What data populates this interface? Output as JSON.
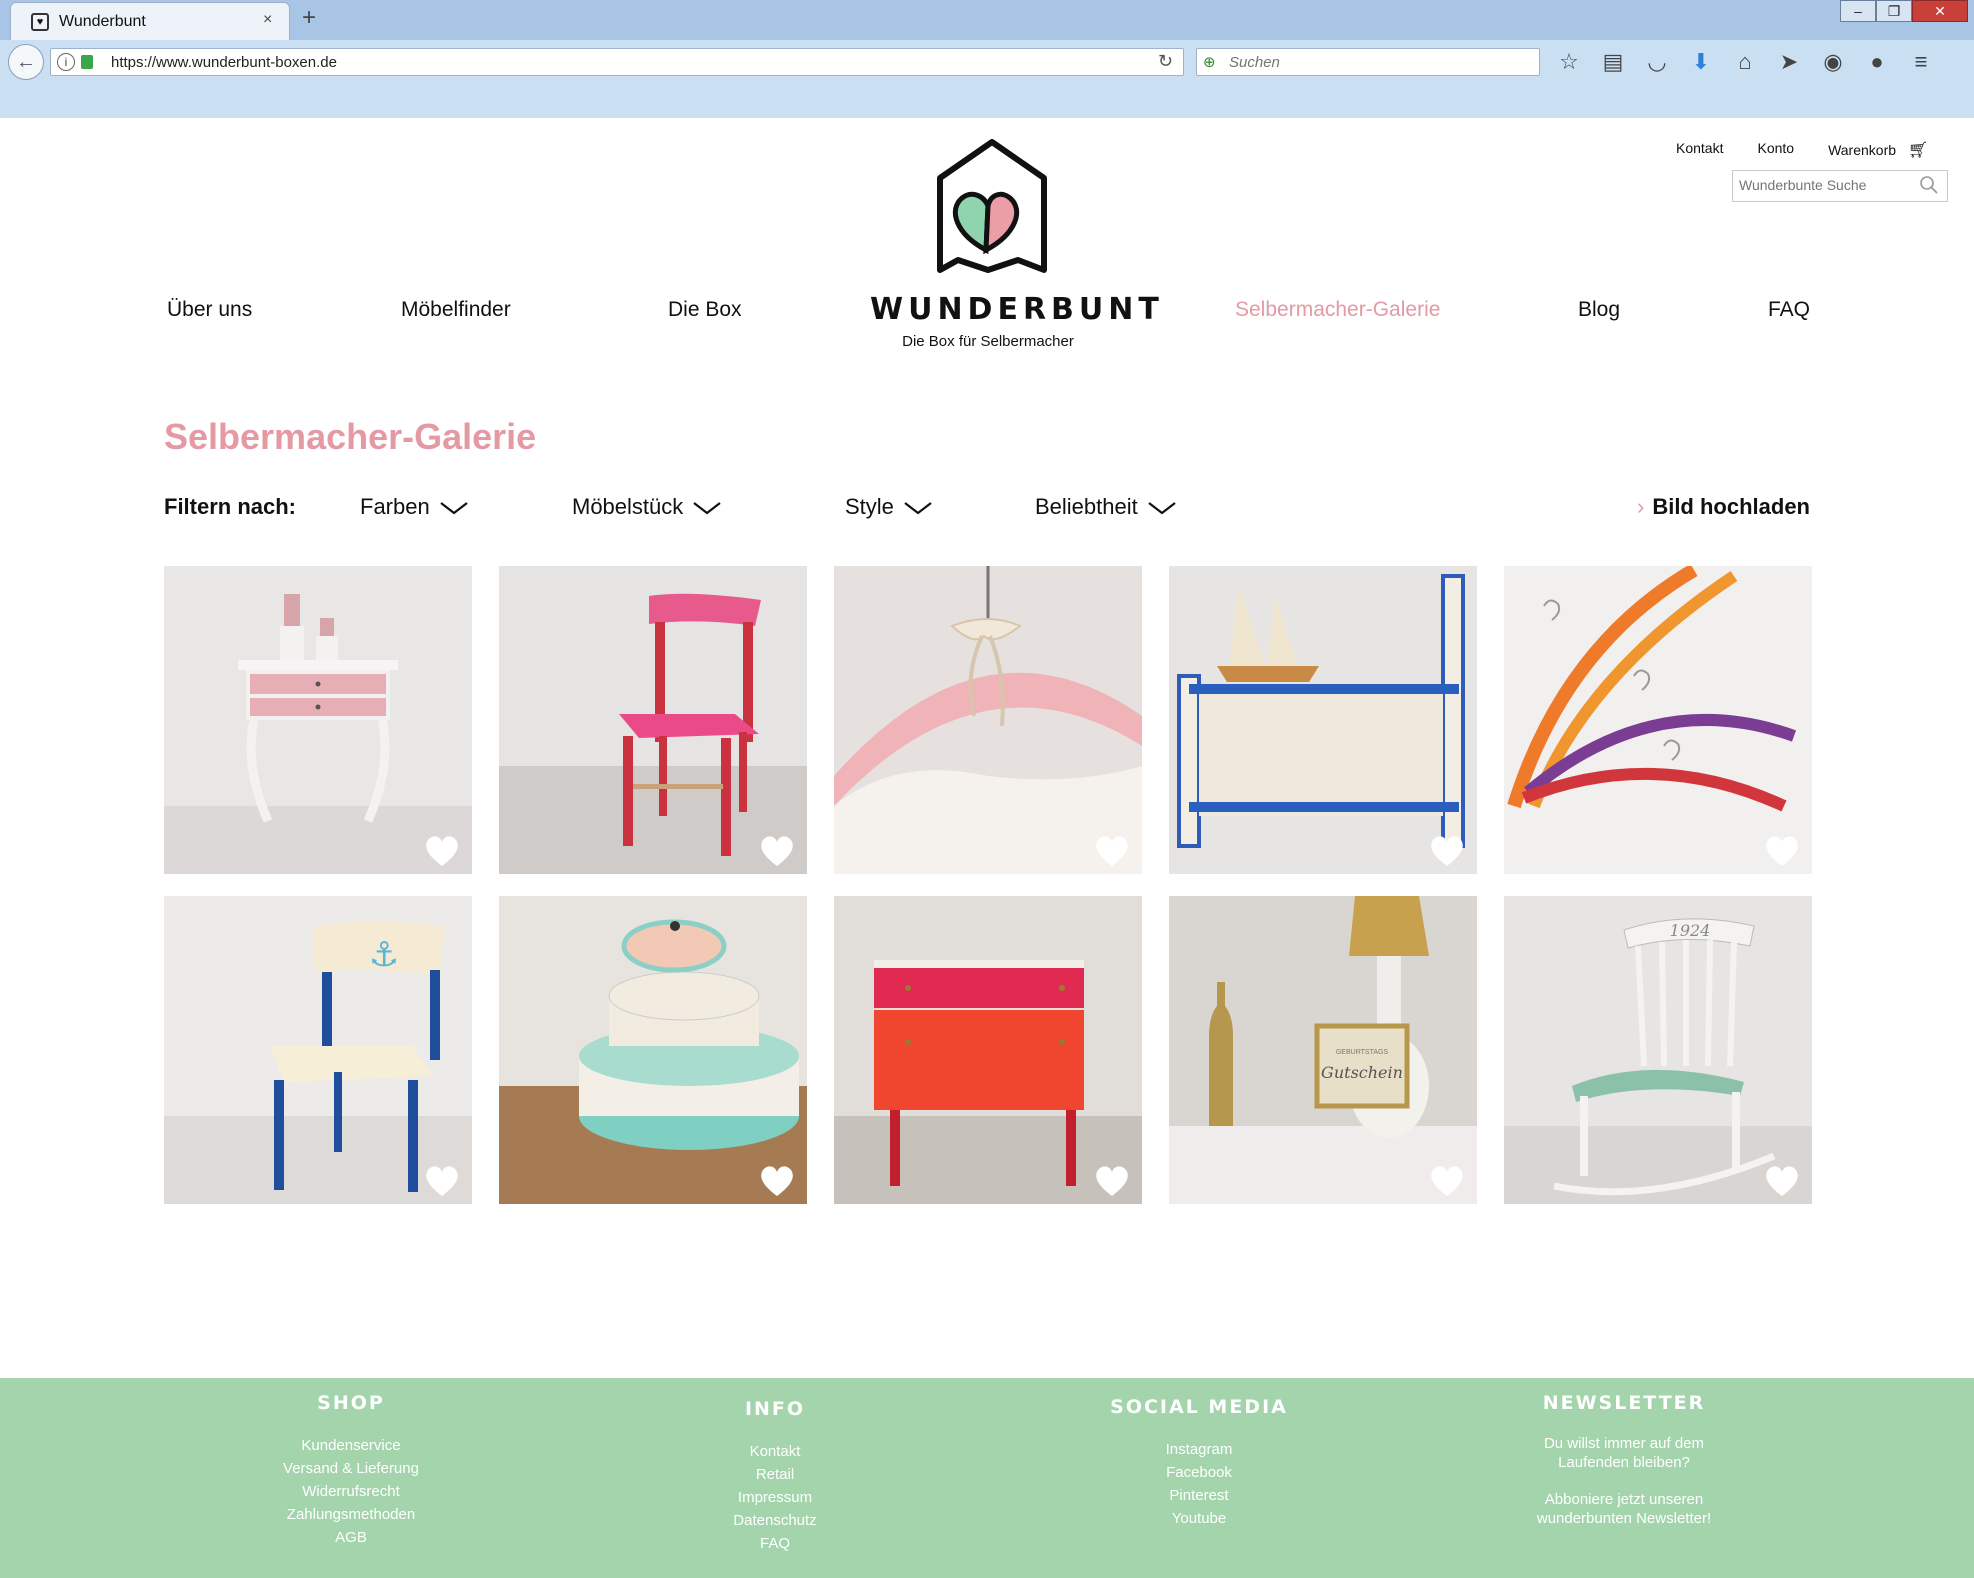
{
  "browser": {
    "tab_title": "Wunderbunt",
    "tab_close": "×",
    "new_tab": "+",
    "url": "https://www.wunderbunt-boxen.de",
    "search_placeholder": "Suchen",
    "window_controls": [
      "–",
      "❐",
      "✕"
    ]
  },
  "header": {
    "util_links": [
      "Kontakt",
      "Konto",
      "Warenkorb"
    ],
    "search_placeholder": "Wunderbunte Suche",
    "logo_title": "WUNDERBUNT",
    "logo_subtitle": "Die Box für Selbermacher",
    "brand_colors": {
      "pink": "#e59aa3",
      "mint": "#a3d4ac",
      "heart_left": "#8fd4ae",
      "heart_right": "#ec9ea6"
    }
  },
  "nav": {
    "items": [
      "Über uns",
      "Möbelfinder",
      "Die Box",
      "Selbermacher-Galerie",
      "Blog",
      "FAQ"
    ],
    "active": "Selbermacher-Galerie"
  },
  "page": {
    "title": "Selbermacher-Galerie",
    "filter_label": "Filtern nach:",
    "filters": [
      "Farben",
      "Möbelstück",
      "Style",
      "Beliebtheit"
    ],
    "upload_label": "Bild hochladen",
    "upload_icon": "›"
  },
  "gallery": {
    "items": [
      {
        "subject": "white-side-table-icon"
      },
      {
        "subject": "pink-red-chair-icon"
      },
      {
        "subject": "pink-hanger-icon"
      },
      {
        "subject": "blue-wall-shelf-icon"
      },
      {
        "subject": "colored-hangers-icon"
      },
      {
        "subject": "anchor-chair-icon"
      },
      {
        "subject": "stacked-boxes-icon"
      },
      {
        "subject": "red-nightstand-icon"
      },
      {
        "subject": "gold-decor-icon"
      },
      {
        "subject": "white-rocking-chair-icon"
      }
    ],
    "rocking_chair_text": "1924",
    "frame_text_top": "GEBURTSTAGS",
    "frame_text_main": "Gutschein"
  },
  "footer": {
    "shop": {
      "heading": "SHOP",
      "links": [
        "Kundenservice",
        "Versand & Lieferung",
        "Widerrufsrecht",
        "Zahlungsmethoden",
        "AGB"
      ]
    },
    "info": {
      "heading": "INFO",
      "links": [
        "Kontakt",
        "Retail",
        "Impressum",
        "Datenschutz",
        "FAQ"
      ]
    },
    "social": {
      "heading": "SOCIAL MEDIA",
      "links": [
        "Instagram",
        "Facebook",
        "Pinterest",
        "Youtube"
      ]
    },
    "newsletter": {
      "heading": "NEWSLETTER",
      "line1": "Du willst immer auf dem",
      "line2": "Laufenden bleiben?",
      "line3": "Abboniere jetzt unseren",
      "line4": "wunderbunten Newsletter!"
    }
  }
}
